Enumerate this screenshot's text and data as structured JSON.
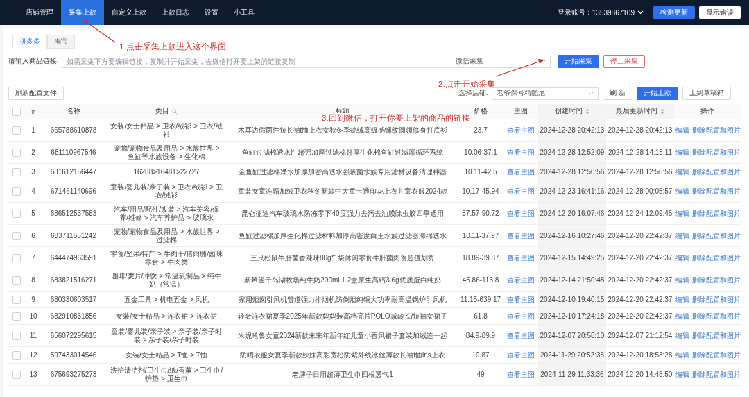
{
  "nav": {
    "items": [
      {
        "label": "店铺管理",
        "selected": false
      },
      {
        "label": "采集上款",
        "selected": true
      },
      {
        "label": "自定义上款",
        "selected": false
      },
      {
        "label": "上款日志",
        "selected": false
      },
      {
        "label": "设置",
        "selected": false
      },
      {
        "label": "小工具",
        "selected": false
      }
    ],
    "account_label": "登录账号：",
    "account": "13539867109",
    "buttons": [
      {
        "label": "检测更新",
        "kind": "primary"
      },
      {
        "label": "显示错误",
        "kind": "plain"
      }
    ]
  },
  "tabs": [
    {
      "label": "拼多多",
      "selected": true
    },
    {
      "label": "淘宝",
      "selected": false
    }
  ],
  "collect": {
    "label": "请输入商品链接:",
    "placeholder": "如需采集下方要编辑链接，复制并开始采集，去微信打开要上架的链接复制",
    "mode": "微信采集",
    "buttons": [
      {
        "label": "开始采集",
        "kind": "primary"
      },
      {
        "label": "停止采集",
        "kind": "danger"
      }
    ]
  },
  "toolbar": {
    "refresh_config": "刷新配置文件",
    "shop_label": "选择店铺:",
    "shop": "老爷保号精能尼",
    "buttons": [
      {
        "label": "刷 新",
        "kind": "plain"
      },
      {
        "label": "开始上款",
        "kind": "primary"
      },
      {
        "label": "上到草稿箱",
        "kind": "plain"
      }
    ]
  },
  "table": {
    "columns": [
      {
        "kind": "checkbox",
        "checked": false
      },
      {
        "label": "#",
        "kind": "text"
      },
      {
        "label": "名称",
        "kind": "text"
      },
      {
        "label": "类目",
        "kind": "filter"
      },
      {
        "label": "标题",
        "kind": "text"
      },
      {
        "label": "价格",
        "kind": "text"
      },
      {
        "label": "主图",
        "kind": "text"
      },
      {
        "label": "创建时间",
        "kind": "sort"
      },
      {
        "label": "最后更新时间",
        "kind": "sort"
      },
      {
        "label": "操作",
        "kind": "text"
      }
    ],
    "rows": [
      {
        "checked": false,
        "index": "1",
        "name": "665788610878",
        "category": "女装/女士精品 > 卫衣/绒衫 > 卫衣/绒衫",
        "title": "木耳边假两件短长袖t恤上衣女秋冬季德绒高级感螺纹圆领修身打底衫",
        "price": "23.7",
        "image": "查看主图",
        "created": "2024-12-28 20:42:13",
        "updated": "2024-12-28 20:42:13",
        "actions": [
          "编辑",
          "删除配置和图片"
        ]
      },
      {
        "checked": false,
        "index": "2",
        "name": "681110967546",
        "category": "宠物/宠物食品及用品 > 水族世界 > 鱼缸等水族设备 > 生化棉",
        "title": "鱼缸过滤棉透水性超强加厚过滤棉超厚生化棉鱼缸过滤器循环系统",
        "price": "10.06-37.1",
        "image": "查看主图",
        "created": "2024-12-28 12:52:09",
        "updated": "2024-12-28 14:18:11",
        "actions": [
          "编辑",
          "删除配置和图片"
        ]
      },
      {
        "checked": false,
        "index": "3",
        "name": "681612156447",
        "category": "16288>16481>22727",
        "title": "金鱼缸过滤棉净水加厚加密高透水强吸菌水族专用滤材设备清理神器",
        "price": "10.11-42.5",
        "image": "查看主图",
        "created": "2024-12-28 12:50:56",
        "updated": "2024-12-28 12:50:56",
        "actions": [
          "编辑",
          "删除配置和图片"
        ]
      },
      {
        "checked": false,
        "index": "4",
        "name": "671461140696",
        "category": "童装/婴儿装/亲子装 > 卫衣/绒衫 > 卫衣/绒衫",
        "title": "童装女童连帽加绒卫衣秋冬新款中大童卡通印花上衣儿童衣服2024款",
        "price": "10.17-45.94",
        "image": "查看主图",
        "created": "2024-12-23 16:41:16",
        "updated": "2024-12-28 00:05:57",
        "actions": [
          "编辑",
          "删除配置和图片"
        ]
      },
      {
        "checked": false,
        "index": "5",
        "name": "686512537583",
        "category": "汽车/用品/配件/改装 > 汽车美容/保养/维修 > 汽车养护品 > 玻璃水",
        "title": "昆仑征途汽车玻璃水防冻零下40度强力去污去油膜除虫胶四季通用",
        "price": "37.57-90.72",
        "image": "查看主图",
        "created": "2024-12-20 16:07:46",
        "updated": "2024-12-24 12:09:45",
        "actions": [
          "编辑",
          "删除配置和图片"
        ]
      },
      {
        "checked": false,
        "index": "6",
        "name": "683711551242",
        "category": "宠物/宠物食品及用品 > 水族世界 > 过滤棉",
        "title": "鱼缸过滤棉加厚生化棉过滤材料加厚高密度白玉水族过滤器海绵透水",
        "price": "10.11-37.97",
        "image": "查看主图",
        "created": "2024-12-16 10:27:46",
        "updated": "2024-12-20 22:42:37",
        "actions": [
          "编辑",
          "删除配置和图片"
        ]
      },
      {
        "checked": false,
        "index": "7",
        "name": "644474963591",
        "category": "零食/坚果/特产 > 牛肉干/猪肉脯/卤味零食 > 牛肉类",
        "title": "三只松鼠牛肝菌香辣味80g*1袋休闲零食牛肝菌肉食超值划算",
        "price": "18.89-39.87",
        "image": "查看主图",
        "created": "2024-12-15 14:49:25",
        "updated": "2024-12-20 22:42:37",
        "actions": [
          "编辑",
          "删除配置和图片"
        ]
      },
      {
        "checked": false,
        "index": "8",
        "name": "683821516271",
        "category": "咖啡/麦片/冲饮 > 常温乳制品 > 纯牛奶（常温）",
        "title": "新希望千岛湖牧场纯牛奶200ml 1 2盒原生高钙3.6g优质蛋白纯奶",
        "price": "45.86-113.8",
        "image": "查看主图",
        "created": "2024-12-14 21:50:48",
        "updated": "2024-12-20 22:42:37",
        "actions": [
          "编辑",
          "删除配置和图片"
        ]
      },
      {
        "checked": false,
        "index": "9",
        "name": "680330603517",
        "category": "五金工具 > 机电五金 > 风机",
        "title": "家用烟囱引风机管道强力排烟机防倒烟纯铜大功率耐高温锅炉引风机",
        "price": "11.15-639.17",
        "image": "查看主图",
        "created": "2024-12-10 19:40:15",
        "updated": "2024-12-20 22:42:37",
        "actions": [
          "编辑",
          "删除配置和图片"
        ]
      },
      {
        "checked": false,
        "index": "10",
        "name": "682910831856",
        "category": "女装/女士精品 > 连衣裙 > 连衣裙",
        "title": "轻奢连衣裙夏季2025年新款妈妈装高档亮片POLO减龄长/短袖女裙子",
        "price": "61.8",
        "image": "查看主图",
        "created": "2024-12-10 17:24:18",
        "updated": "2024-12-20 22:42:37",
        "actions": [
          "编辑",
          "删除配置和图片"
        ]
      },
      {
        "checked": false,
        "index": "11",
        "name": "656072295615",
        "category": "童装/婴儿装/亲子装 > 亲子装/亲子时装 > 亲子装/亲子时装",
        "title": "米妮哈鲁女童2024新款末来年新年红儿童小香风裙子套装加绒连一起",
        "price": "84.9-89.9",
        "image": "查看主图",
        "created": "2024-12-07 20:58:10",
        "updated": "2024-12-07 21:12:54",
        "actions": [
          "编辑",
          "删除配置和图片"
        ]
      },
      {
        "checked": false,
        "index": "12",
        "name": "597433014546",
        "category": "女装/女士精品 > T恤 > T恤",
        "title": "防晒衣服女夏季新款辣妹高彩宽松防紫外线冰丝薄款长袖t恤ins上衣",
        "price": "19.87",
        "image": "查看主图",
        "created": "2024-11-29 20:52:38",
        "updated": "2024-12-20 18:53:28",
        "actions": [
          "编辑",
          "删除配置和图片"
        ]
      },
      {
        "checked": false,
        "index": "13",
        "name": "675693275273",
        "category": "洗护清洁剂/卫生巾/纸/香薰 > 卫生巾/护垫 > 卫生巾",
        "title": "老牌子日用超薄卫生巾四根透气1",
        "price": "49",
        "image": "查看主图",
        "created": "2024-11-29 11:33:36",
        "updated": "2024-12-20 14:48:50",
        "actions": [
          "编辑",
          "删除配置和图片"
        ]
      }
    ]
  },
  "annotations": [
    {
      "text": "1.点击采集上款进入这个界面"
    },
    {
      "text": "2.点击开始采集"
    },
    {
      "text": "3.回到微信，打开你要上架的商品的链接"
    }
  ]
}
